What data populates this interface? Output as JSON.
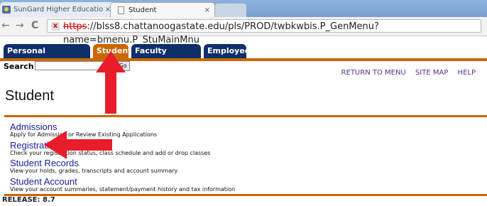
{
  "browser": {
    "tabs": [
      {
        "title": "SunGard Higher Educatio",
        "close": "×"
      },
      {
        "title": "Student",
        "close": "×"
      }
    ],
    "nav": {
      "back": "←",
      "forward": "→",
      "reload": "C"
    },
    "url": {
      "scheme": "https",
      "rest": "://blss8.chattanoogastate.edu/pls/PROD/twbkwbis.P_GenMenu?name=bmenu.P_StuMainMnu"
    }
  },
  "banner": {
    "tabs": [
      "Personal Information",
      "Student",
      "Faculty Services",
      "Employee"
    ],
    "active_tab": "Student",
    "accent_color": "#cc6600",
    "tab_color": "#0f2f6b"
  },
  "search": {
    "label": "Search",
    "go_label": "Go",
    "value": ""
  },
  "top_links": [
    "RETURN TO MENU",
    "SITE MAP",
    "HELP"
  ],
  "page_title": "Student",
  "menu": [
    {
      "title": "Admissions",
      "description": "Apply for Admission or Review Existing Applications"
    },
    {
      "title": "Registration",
      "description": "Check your registration status, class schedule and add or drop classes"
    },
    {
      "title": "Student Records",
      "description": "View your holds, grades, transcripts and account summary"
    },
    {
      "title": "Student Account",
      "description": "View your account summaries, statement/payment history and tax information"
    }
  ],
  "release": "RELEASE: 8.7"
}
